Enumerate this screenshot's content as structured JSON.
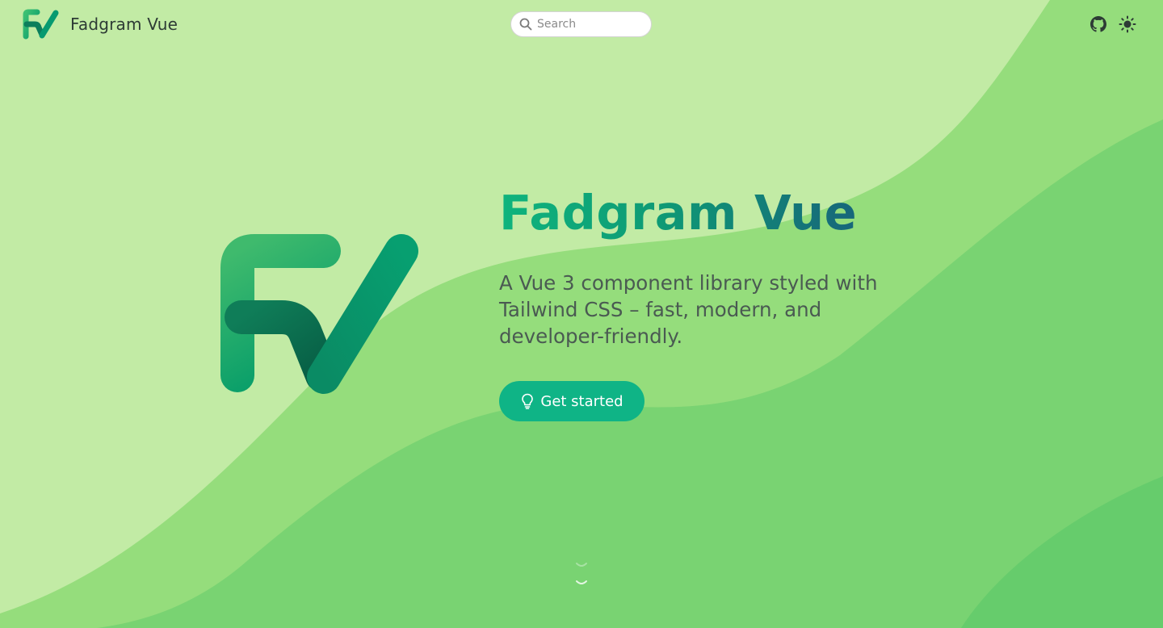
{
  "header": {
    "brand_name": "Fadgram Vue",
    "search_placeholder": "Search",
    "github_icon": "github-icon",
    "theme_icon": "sun-icon"
  },
  "hero": {
    "title": "Fadgram Vue",
    "subtitle": "A Vue 3 component library styled with Tailwind CSS – fast, modern, and developer-friendly.",
    "cta_label": "Get started",
    "cta_icon": "lightbulb-icon",
    "scroll_icon": "chevron-down-icon"
  },
  "colors": {
    "background": "#c2eba5",
    "wave_mid": "#95dd7c",
    "wave_dark": "#72d170",
    "accent": "#0fb486",
    "title_gradient_start": "#0fb47d",
    "title_gradient_end": "#17667a",
    "text": "#4a5a52"
  }
}
